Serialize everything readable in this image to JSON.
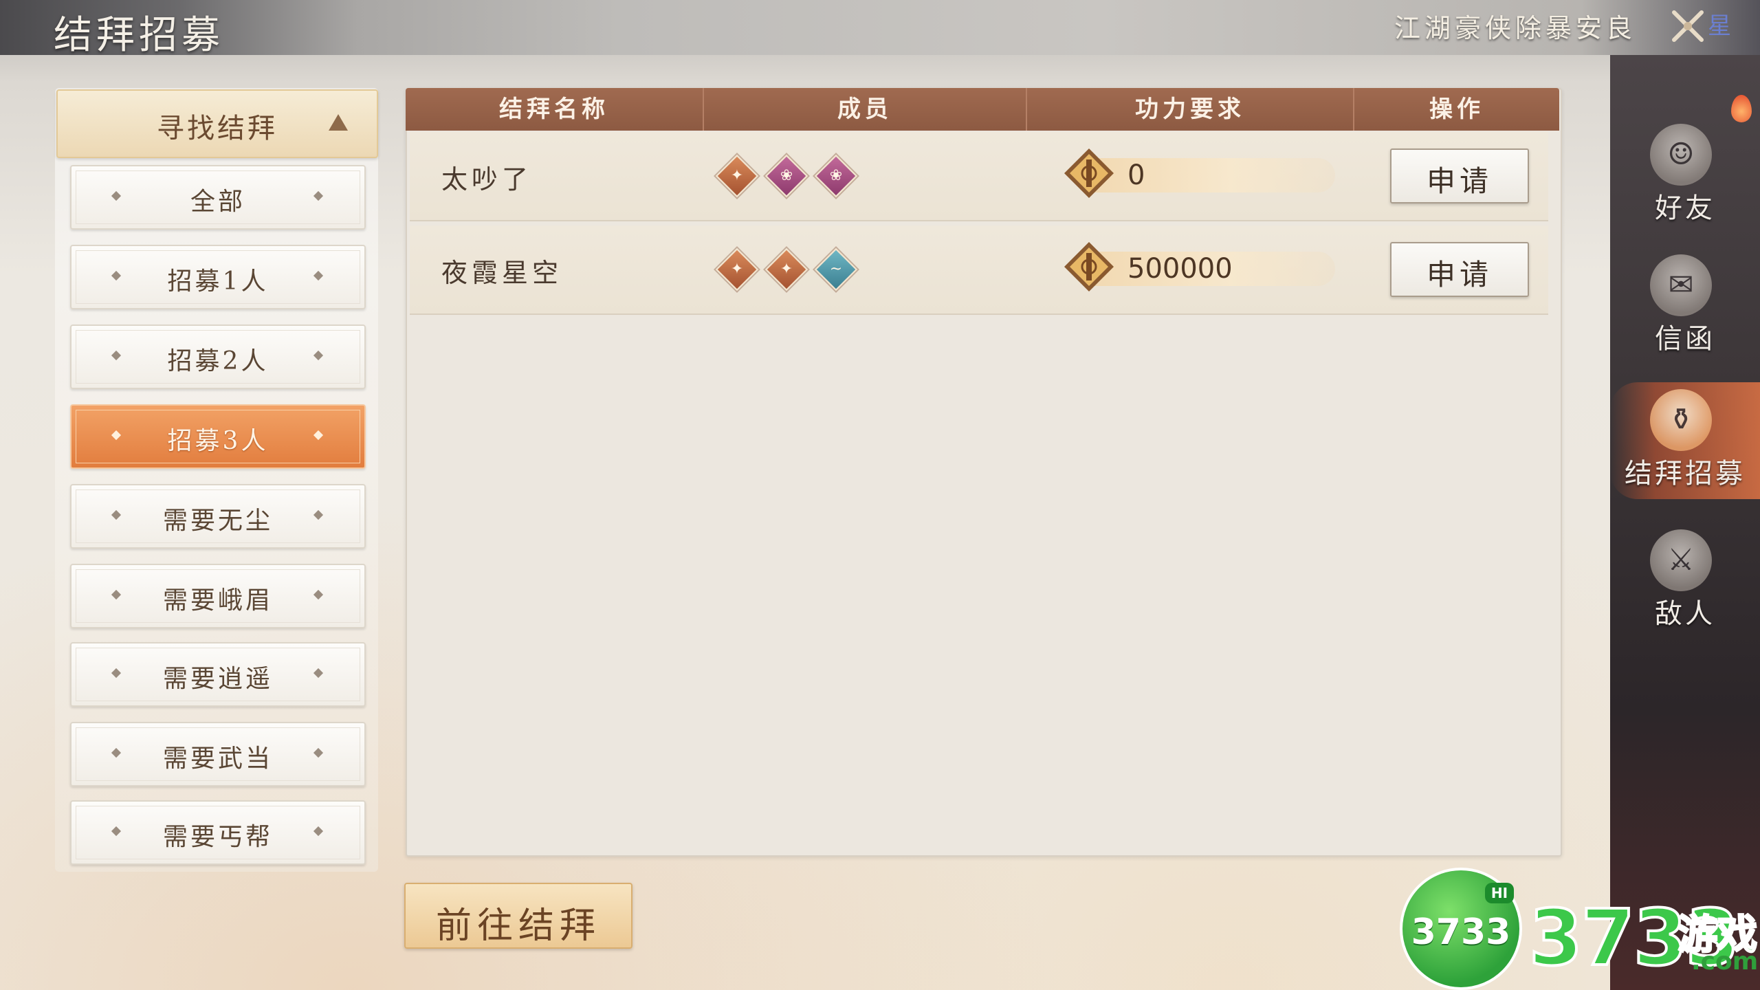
{
  "header": {
    "title": "结拜招募",
    "ribbon_text": "江湖豪侠除暴安良",
    "ribbon_extra": "星"
  },
  "sidebar": {
    "header_label": "寻找结拜",
    "items": [
      {
        "label": "全部"
      },
      {
        "label": "招募1人"
      },
      {
        "label": "招募2人"
      },
      {
        "label": "招募3人",
        "active": true
      },
      {
        "label": "需要无尘"
      },
      {
        "label": "需要峨眉"
      },
      {
        "label": "需要逍遥"
      },
      {
        "label": "需要武当"
      },
      {
        "label": "需要丐帮"
      }
    ]
  },
  "table": {
    "columns": [
      "结拜名称",
      "成员",
      "功力要求",
      "操作"
    ],
    "rows": [
      {
        "name": "太吵了",
        "members": [
          "orange",
          "purple",
          "purple"
        ],
        "power": "0",
        "action": "申请"
      },
      {
        "name": "夜霞星空",
        "members": [
          "orange",
          "orange",
          "teal"
        ],
        "power": "500000",
        "action": "申请"
      }
    ]
  },
  "footer": {
    "go_button": "前往结拜"
  },
  "right_nav": {
    "items": [
      {
        "label": "好友",
        "icon": "friend-icon"
      },
      {
        "label": "信函",
        "icon": "letter-icon"
      },
      {
        "label": "结拜招募",
        "icon": "sworn-recruit-icon",
        "active": true
      },
      {
        "label": "敌人",
        "icon": "enemy-icon"
      }
    ]
  },
  "watermark": {
    "badge": "3733",
    "hi": "HI",
    "brand": "3733",
    "brand_cn": "游戏",
    "domain": ".com"
  },
  "colors": {
    "accent_orange": "#e27d3e",
    "header_brown": "#8d5a42",
    "member_orange": "#a55331",
    "member_purple": "#8e3a6d",
    "member_teal": "#3b7f91"
  }
}
